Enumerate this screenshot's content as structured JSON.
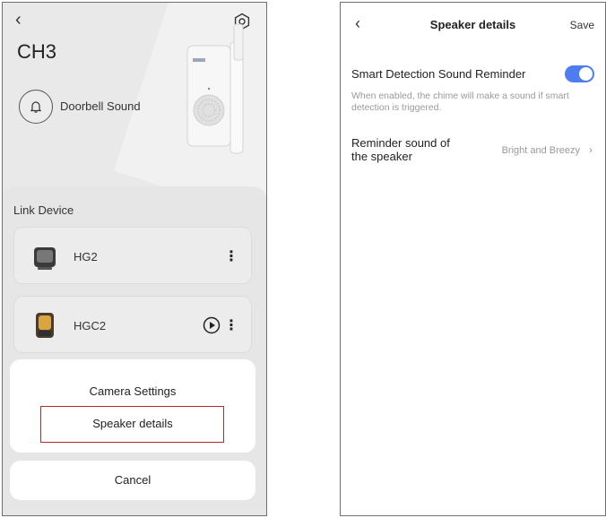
{
  "left_screen": {
    "back_icon": "chevron-left-icon",
    "settings_icon": "settings-icon",
    "device_title": "CH3",
    "doorbell_sound_label": "Doorbell Sound",
    "link_device_title": "Link Device",
    "devices": [
      {
        "name": "HG2"
      },
      {
        "name": "HGC2"
      }
    ],
    "action_sheet": {
      "camera_settings": "Camera Settings",
      "speaker_details": "Speaker details",
      "cancel": "Cancel"
    },
    "highlight_color": "#c0272d"
  },
  "right_screen": {
    "back_icon": "chevron-left-icon",
    "title": "Speaker details",
    "save_label": "Save",
    "smart_detection": {
      "label": "Smart Detection Sound Reminder",
      "enabled": true,
      "description": "When enabled, the chime will make a sound if smart detection is triggered."
    },
    "reminder_sound": {
      "label": "Reminder sound of the speaker",
      "value": "Bright and Breezy"
    },
    "toggle_color": "#4d7df0"
  }
}
